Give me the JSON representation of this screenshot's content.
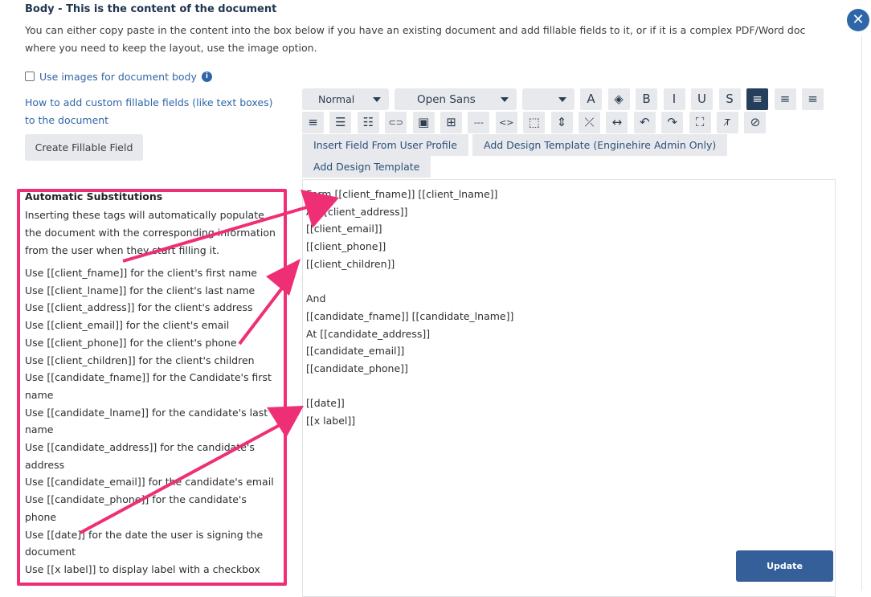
{
  "body_section": {
    "title": "Body - This is the content of the document",
    "description": "You can either copy paste in the content into the box below if you have an existing document and add fillable fields to it, or if it is a complex PDF/Word doc where you need to keep the layout, use the image option."
  },
  "close_icon_glyph": "✕",
  "use_images": {
    "label": "Use images for document body",
    "checked": false,
    "info_glyph": "i"
  },
  "help_link": "How to add custom fillable fields (like text boxes) to the document",
  "create_fillable_field_button": "Create Fillable Field",
  "toolbar": {
    "paragraph_style": "Normal",
    "font_family": "Open Sans",
    "font_size": "",
    "row1_icons": [
      {
        "name": "font-color-icon",
        "glyph": "A"
      },
      {
        "name": "fill-color-icon",
        "glyph": "◈"
      },
      {
        "name": "bold-icon",
        "glyph": "B"
      },
      {
        "name": "italic-icon",
        "glyph": "I"
      },
      {
        "name": "underline-icon",
        "glyph": "U"
      },
      {
        "name": "strikethrough-icon",
        "glyph": "S"
      },
      {
        "name": "align-left-icon",
        "glyph": "≡",
        "active": true
      },
      {
        "name": "align-center-icon",
        "glyph": "≡"
      },
      {
        "name": "align-right-icon",
        "glyph": "≡"
      }
    ],
    "row2_icons": [
      {
        "name": "align-justify-icon",
        "glyph": "≡"
      },
      {
        "name": "bullet-list-icon",
        "glyph": "☰"
      },
      {
        "name": "numbered-list-icon",
        "glyph": "☷"
      },
      {
        "name": "link-icon",
        "glyph": "⊂⊃"
      },
      {
        "name": "image-icon",
        "glyph": "▣"
      },
      {
        "name": "table-icon",
        "glyph": "⊞"
      },
      {
        "name": "horizontal-rule-icon",
        "glyph": "---"
      },
      {
        "name": "code-view-icon",
        "glyph": "<>"
      },
      {
        "name": "select-all-icon",
        "glyph": "⬚"
      },
      {
        "name": "expand-icon",
        "glyph": "⇕"
      },
      {
        "name": "collapse-icon",
        "glyph": "⤫"
      },
      {
        "name": "full-width-icon",
        "glyph": "↔"
      },
      {
        "name": "undo-icon",
        "glyph": "↶"
      },
      {
        "name": "redo-icon",
        "glyph": "↷"
      },
      {
        "name": "fullscreen-icon",
        "glyph": "⛶"
      },
      {
        "name": "clear-format-icon",
        "glyph": "T̸"
      },
      {
        "name": "no-style-icon",
        "glyph": "⊘"
      }
    ],
    "insert_field_from_user_profile": "Insert Field From User Profile",
    "add_design_template_admin": "Add Design Template (Enginehire Admin Only)",
    "add_design_template": "Add Design Template"
  },
  "editor_lines": [
    "Form [[client_fname]] [[client_lname]]",
    "At [[client_address]]",
    "[[client_email]]",
    "[[client_phone]]",
    "[[client_children]]",
    "",
    "And",
    "[[candidate_fname]] [[candidate_lname]]",
    "At [[candidate_address]]",
    "[[candidate_email]]",
    "[[candidate_phone]]",
    "",
    "[[date]]",
    "[[x label]]"
  ],
  "update_button": "Update",
  "substitutions": {
    "title": "Automatic Substitutions",
    "intro": "Inserting these tags will automatically populate the document with the corresponding information from the user when they start filling it.",
    "items": [
      "Use [[client_fname]] for the client's first name",
      "Use [[client_lname]] for the client's last name",
      "Use [[client_address]] for the client's address",
      "Use [[client_email]] for the client's email",
      "Use [[client_phone]] for the client's phone",
      "Use [[client_children]] for the client's children",
      "Use [[candidate_fname]] for the Candidate's first name",
      "Use [[candidate_lname]] for the candidate's last name",
      "Use [[candidate_address]] for the candidate's address",
      "Use [[candidate_email]] for the candidate's email",
      "Use [[candidate_phone]] for the candidate's phone",
      "Use [[date]] for the date the user is signing the document",
      "Use [[x label]] to display label with a checkbox"
    ]
  },
  "colors": {
    "highlight": "#ef2f75",
    "accent": "#2f66a8",
    "toolbar_active": "#243e5c",
    "update_button": "#345f98"
  }
}
